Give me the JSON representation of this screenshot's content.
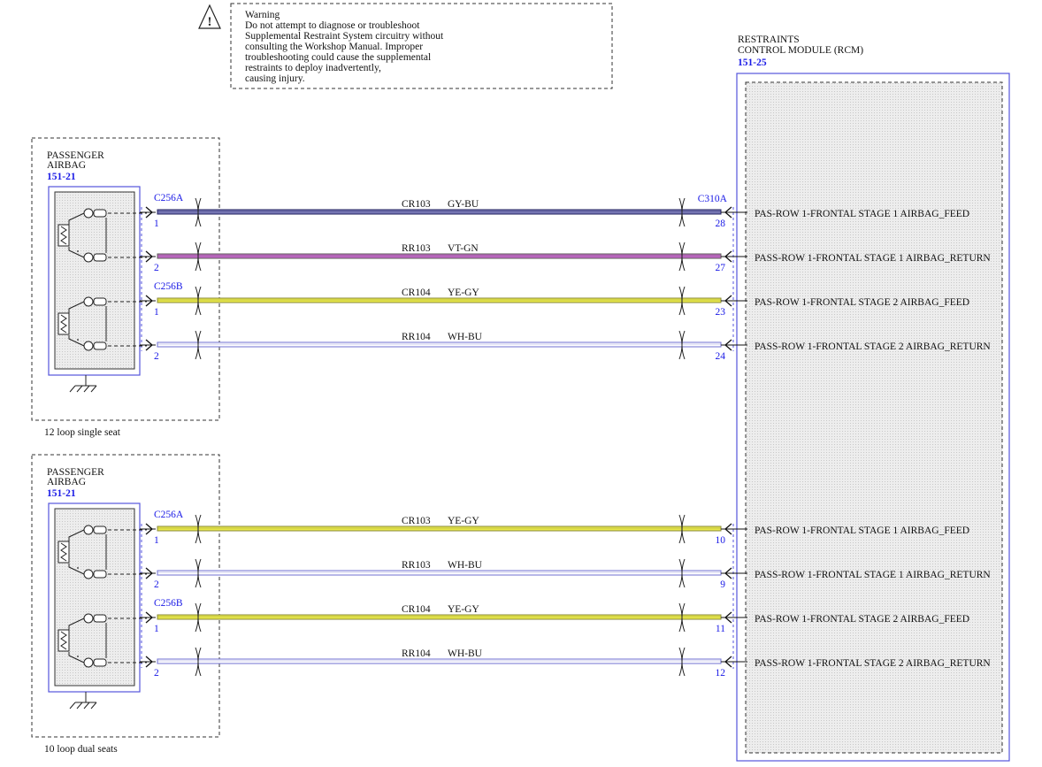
{
  "warning": {
    "title": "Warning",
    "lines": [
      "Do not attempt to diagnose or troubleshoot",
      "Supplemental Restraint System circuitry without",
      "consulting the Workshop Manual. Improper",
      "troubleshooting could cause the supplemental",
      "restraints to deploy inadvertently,",
      "causing injury."
    ]
  },
  "rcm": {
    "name_line1": "RESTRAINTS",
    "name_line2": "CONTROL MODULE (RCM)",
    "ref": "151-25",
    "connector": "C310A"
  },
  "variants": [
    {
      "caption": "12 loop single seat",
      "component_line1": "PASSENGER",
      "component_line2": "AIRBAG",
      "component_ref": "151-21",
      "wires": [
        {
          "connector": "C256A",
          "pin": "1",
          "circuit": "CR103",
          "color_code": "GY-BU",
          "rcm_pin": "28",
          "signal": "PAS-ROW 1-FRONTAL STAGE 1 AIRBAG_FEED",
          "c1": "#7a7ab8",
          "c2": "#1f1f5c"
        },
        {
          "connector": "",
          "pin": "2",
          "circuit": "RR103",
          "color_code": "VT-GN",
          "rcm_pin": "27",
          "signal": "PASS-ROW 1-FRONTAL STAGE 1 AIRBAG_RETURN",
          "c1": "#c267c8",
          "c2": "#5e5e58"
        },
        {
          "connector": "C256B",
          "pin": "1",
          "circuit": "CR104",
          "color_code": "YE-GY",
          "rcm_pin": "23",
          "signal": "PAS-ROW 1-FRONTAL STAGE 2 AIRBAG_FEED",
          "c1": "#e8e84a",
          "c2": "#8a8a3a"
        },
        {
          "connector": "",
          "pin": "2",
          "circuit": "RR104",
          "color_code": "WH-BU",
          "rcm_pin": "24",
          "signal": "PASS-ROW 1-FRONTAL STAGE 2 AIRBAG_RETURN",
          "c1": "#ffffff",
          "c2": "#6f6fd0"
        }
      ]
    },
    {
      "caption": "10 loop dual seats",
      "component_line1": "PASSENGER",
      "component_line2": "AIRBAG",
      "component_ref": "151-21",
      "wires": [
        {
          "connector": "C256A",
          "pin": "1",
          "circuit": "CR103",
          "color_code": "YE-GY",
          "rcm_pin": "10",
          "signal": "PAS-ROW 1-FRONTAL STAGE 1 AIRBAG_FEED",
          "c1": "#e8e84a",
          "c2": "#8a8a3a"
        },
        {
          "connector": "",
          "pin": "2",
          "circuit": "RR103",
          "color_code": "WH-BU",
          "rcm_pin": "9",
          "signal": "PASS-ROW 1-FRONTAL STAGE 1 AIRBAG_RETURN",
          "c1": "#ffffff",
          "c2": "#6f6fd0"
        },
        {
          "connector": "C256B",
          "pin": "1",
          "circuit": "CR104",
          "color_code": "YE-GY",
          "rcm_pin": "11",
          "signal": "PAS-ROW 1-FRONTAL STAGE 2 AIRBAG_FEED",
          "c1": "#e8e84a",
          "c2": "#8a8a3a"
        },
        {
          "connector": "",
          "pin": "2",
          "circuit": "RR104",
          "color_code": "WH-BU",
          "rcm_pin": "12",
          "signal": "PASS-ROW 1-FRONTAL STAGE 2 AIRBAG_RETURN",
          "c1": "#ffffff",
          "c2": "#6f6fd0"
        }
      ]
    }
  ]
}
